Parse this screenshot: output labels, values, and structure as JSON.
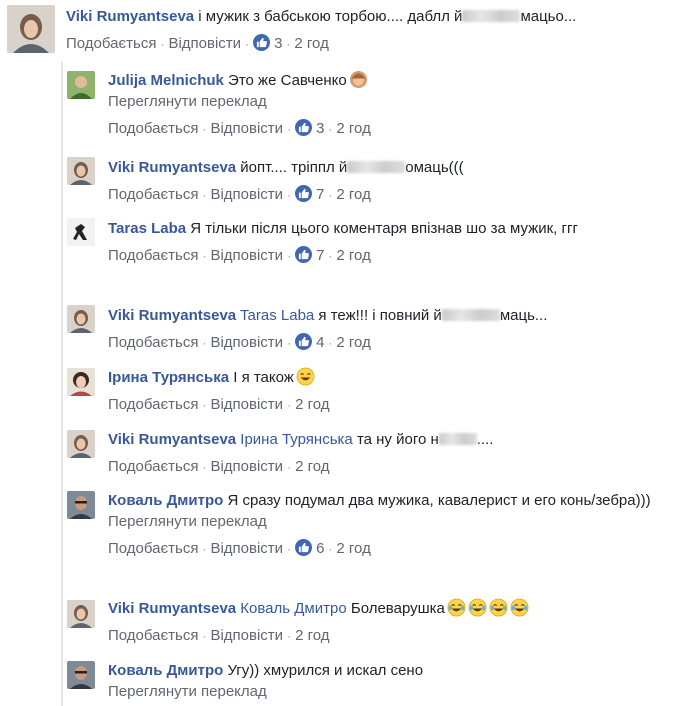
{
  "actions": {
    "like": "Подобається",
    "reply": "Відповісти",
    "translate": "Переглянути переклад"
  },
  "comments": [
    {
      "author": "Viki Rumyantseva",
      "text_before": "і мужик з бабською торбою.... даблл й",
      "text_after": "мацьо...",
      "likes": "3",
      "time": "2 год"
    },
    {
      "author": "Julija Melnichuk",
      "text": "Это же Савченко",
      "time": "2 год",
      "likes": "3"
    },
    {
      "author": "Viki Rumyantseva",
      "text_before": "йопт.... тріппл й",
      "text_after": "омаць(((",
      "likes": "7",
      "time": "2 год"
    },
    {
      "author": "Taras Laba",
      "text": "Я тільки після цього коментаря впізнав шо за мужик, ггг",
      "likes": "7",
      "time": "2 год"
    },
    {
      "author": "Viki Rumyantseva",
      "mention": "Taras Laba",
      "text_before": "я теж!!! і повний й",
      "text_after": "маць...",
      "likes": "4",
      "time": "2 год"
    },
    {
      "author": "Ірина Турянська",
      "text": "І я також",
      "time": "2 год"
    },
    {
      "author": "Viki Rumyantseva",
      "mention": "Ірина Турянська",
      "text_before": "та ну його н",
      "text_after": "....",
      "time": "2 год"
    },
    {
      "author": "Коваль Дмитро",
      "text": "Я сразу подумал два мужика, кавалерист и его конь/зебра)))",
      "likes": "6",
      "time": "2 год"
    },
    {
      "author": "Viki Rumyantseva",
      "mention": "Коваль Дмитро",
      "text": "Болеварушка",
      "time": "2 год"
    },
    {
      "author": "Коваль Дмитро",
      "text": "Угу)) хмурился и искал сено"
    }
  ],
  "colors": {
    "link": "#385898",
    "meta": "#606770",
    "like_badge": "#4267b2"
  }
}
